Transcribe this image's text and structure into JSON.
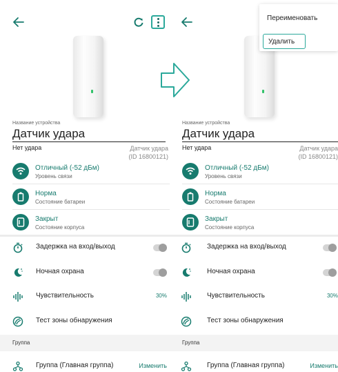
{
  "left_screen": {
    "name_caption": "Название устройства",
    "device_name": "Датчик удара",
    "state": "Нет удара",
    "model_line1": "Датчик удара",
    "model_line2": "(ID 16800121)",
    "signal_value": "Отличный (-52 дБм)",
    "signal_caption": "Уровень связи",
    "battery_value": "Норма",
    "battery_caption": "Состояние батареи",
    "case_value": "Закрыт",
    "case_caption": "Состояние корпуса",
    "entry_delay": "Задержка на вход/выход",
    "night_guard": "Ночная охрана",
    "sensitivity": "Чувствительность",
    "sensitivity_value": "30%",
    "zone_test": "Тест зоны обнаружения",
    "group_header": "Группа",
    "group_value": "Группа (Главная группа)",
    "group_change": "Изменить"
  },
  "right_screen": {
    "name_caption": "Название устройства",
    "device_name": "Датчик удара",
    "state": "Нет удара",
    "model_line1": "Датчик удара",
    "model_line2": "(ID 16800121)",
    "signal_value": "Отличный (-52 дБм)",
    "signal_caption": "Уровень связи",
    "battery_value": "Норма",
    "battery_caption": "Состояние батареи",
    "case_value": "Закрыт",
    "case_caption": "Состояние корпуса",
    "entry_delay": "Задержка на вход/выход",
    "night_guard": "Ночная охрана",
    "sensitivity": "Чувствительность",
    "sensitivity_value": "30%",
    "zone_test": "Тест зоны обнаружения",
    "group_header": "Группа",
    "group_value": "Группа (Главная группа)",
    "group_change": "Изменить"
  },
  "context_menu": {
    "rename": "Переименовать",
    "delete": "Удалить"
  },
  "colors": {
    "accent": "#177b6e",
    "highlight": "#2aa89a"
  },
  "icons": [
    "back-arrow-icon",
    "refresh-icon",
    "more-vertical-icon",
    "wifi-icon",
    "battery-icon",
    "case-icon",
    "timer-icon",
    "moon-icon",
    "sensitivity-icon",
    "zone-test-icon",
    "group-icon",
    "transition-arrow-icon"
  ],
  "toggles": {
    "entry_delay": false,
    "night_guard": false
  }
}
